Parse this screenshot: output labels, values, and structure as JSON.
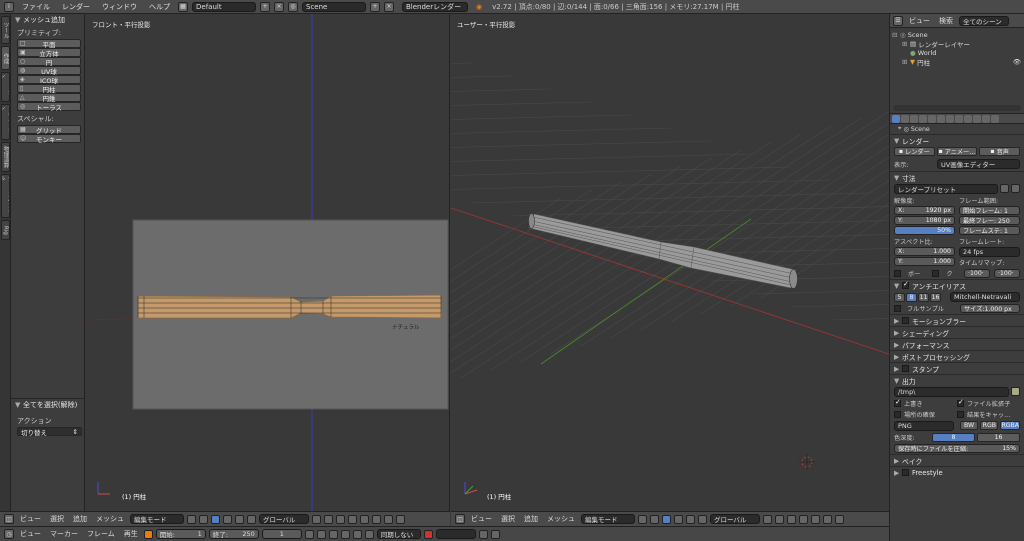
{
  "topbar": {
    "menus": [
      "ファイル",
      "レンダー",
      "ウィンドウ",
      "ヘルプ"
    ],
    "layout": "Default",
    "scene": "Scene",
    "engine": "Blenderレンダー",
    "stats": "v2.72 | 頂点:0/80 | 辺:0/144 | 面:0/66 | 三角面:156 | メモリ:27.17M | 円柱"
  },
  "tooltabs": [
    "ツール",
    "作成",
    "リレーション",
    "アニメーション",
    "物理演算",
    "グリースペンシル",
    "Rig"
  ],
  "toolpanel": {
    "title": "メッシュ追加",
    "primitive_label": "プリミティブ:",
    "primitives": [
      "平面",
      "立方体",
      "円",
      "UV球",
      "ICO球",
      "円柱",
      "円錐",
      "トーラス"
    ],
    "special_label": "スペシャル:",
    "specials": [
      "グリッド",
      "モンキー"
    ],
    "op_title": "全てを選択(解除)",
    "action_label": "アクション",
    "action_value": "切り替え"
  },
  "left_view": {
    "label": "フロント・平行投影",
    "object": "(1) 円柱",
    "bg_text": "ナチュラル"
  },
  "right_view": {
    "label": "ユーザー・平行投影",
    "object": "(1) 円柱"
  },
  "left_header": {
    "menus": [
      "ビュー",
      "選択",
      "追加",
      "メッシュ"
    ],
    "mode": "編集モード",
    "orientation": "グローバル"
  },
  "right_header": {
    "menus": [
      "ビュー",
      "選択",
      "追加",
      "メッシュ"
    ],
    "mode": "編集モード",
    "orientation": "グローバル"
  },
  "timeline": {
    "menus": [
      "ビュー",
      "マーカー",
      "フレーム",
      "再生"
    ],
    "start_label": "開始:",
    "start": "1",
    "end_label": "終了:",
    "end": "250",
    "current": "1",
    "sync": "同期しない"
  },
  "outliner": {
    "menus": [
      "ビュー",
      "検索"
    ],
    "filter": "全てのシーン",
    "items": [
      "Scene",
      "レンダーレイヤー",
      "World",
      "円柱"
    ]
  },
  "properties": {
    "scene_label": "Scene",
    "render_section": "レンダー",
    "render_buttons": [
      "レンダー",
      "アニメー…",
      "音声"
    ],
    "display_label": "表示:",
    "display_value": "UV画像エディター",
    "dimensions_section": "寸法",
    "preset": "レンダープリセット",
    "resolution_label": "解像度:",
    "res_x_label": "X:",
    "res_x": "1920 px",
    "res_y_label": "Y:",
    "res_y": "1080 px",
    "res_pct": "50%",
    "frame_range_label": "フレーム範囲:",
    "frame_start": "開始フレーム: 1",
    "frame_end": "最終フレー: 250",
    "frame_step": "フレームステ: 1",
    "aspect_label": "アスペクト比:",
    "asp_x_label": "X:",
    "asp_x": "1.000",
    "asp_y_label": "Y:",
    "asp_y": "1.000",
    "framerate_label": "フレームレート:",
    "framerate": "24 fps",
    "timemap_label": "タイムリマップ:",
    "timemap_old": "·100·",
    "timemap_new": "·100·",
    "border_label": "ボー",
    "crop_label": "ク",
    "aa_section": "アンチエイリアス",
    "aa_values": [
      "5",
      "8",
      "11",
      "16"
    ],
    "aa_filter": "Mitchell-Netravali",
    "full_sample": "フルサンプル",
    "aa_size": "サイズ:1.000 px",
    "sections": [
      "モーションブラー",
      "シェーディング",
      "パフォーマンス",
      "ポストプロセッシング",
      "スタンプ",
      "出力"
    ],
    "output_path": "/tmp\\",
    "overwrite": "上書き",
    "file_ext": "ファイル拡張子",
    "placeholders": "場所の確保",
    "cache_result": "結果をキャッ…",
    "format": "PNG",
    "color_modes": [
      "BW",
      "RGB",
      "RGBA"
    ],
    "color_depth_label": "色深度:",
    "color_depths": [
      "8",
      "16"
    ],
    "compression_label": "保存時にファイルを圧縮:",
    "compression": "15%",
    "bake_section": "ベイク",
    "freestyle_section": "Freestyle"
  },
  "colors": {
    "accent": "#5680c2",
    "selected_edge": "#f0a030",
    "x_axis": "#b83a3a",
    "y_axis": "#5a9a3a",
    "z_axis": "#3a3ab8"
  }
}
